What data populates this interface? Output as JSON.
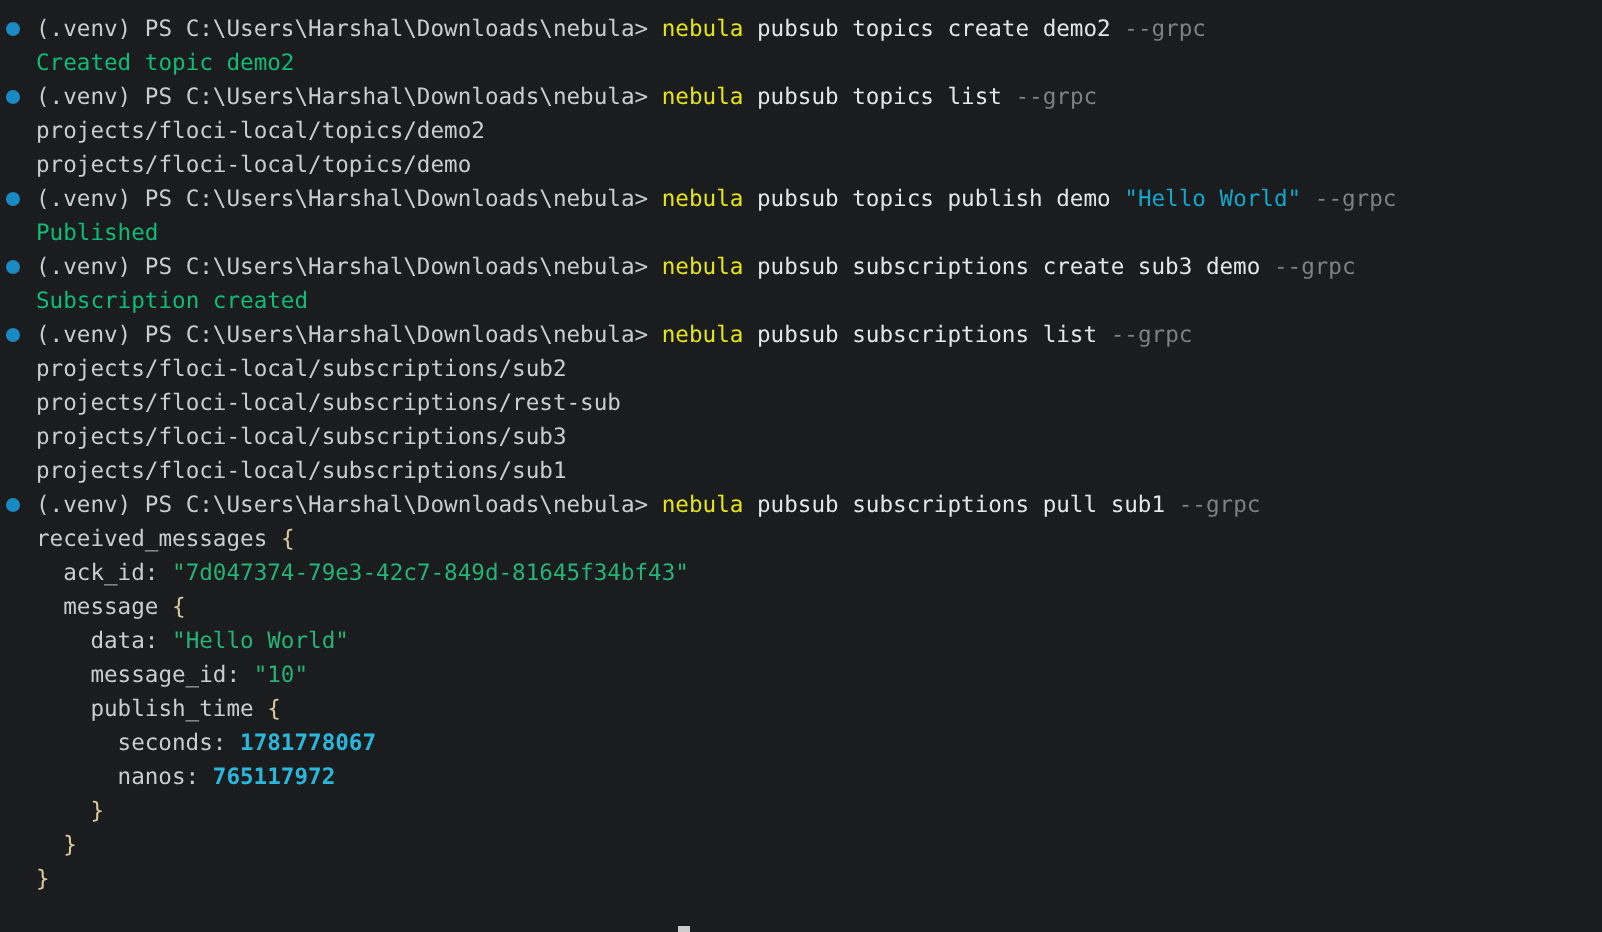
{
  "session": [
    {
      "prompt": "(.venv) PS C:\\Users\\Harshal\\Downloads\\nebula>",
      "command": [
        {
          "kind": "program",
          "text": "nebula"
        },
        {
          "kind": "args",
          "text": "pubsub topics create demo2"
        },
        {
          "kind": "flag",
          "text": "--grpc"
        }
      ],
      "output": [
        {
          "kind": "success",
          "text": "Created topic demo2"
        }
      ]
    },
    {
      "prompt": "(.venv) PS C:\\Users\\Harshal\\Downloads\\nebula>",
      "command": [
        {
          "kind": "program",
          "text": "nebula"
        },
        {
          "kind": "args",
          "text": "pubsub topics list"
        },
        {
          "kind": "flag",
          "text": "--grpc"
        }
      ],
      "output": [
        {
          "kind": "plain",
          "text": "projects/floci-local/topics/demo2"
        },
        {
          "kind": "plain",
          "text": "projects/floci-local/topics/demo"
        }
      ]
    },
    {
      "prompt": "(.venv) PS C:\\Users\\Harshal\\Downloads\\nebula>",
      "command": [
        {
          "kind": "program",
          "text": "nebula"
        },
        {
          "kind": "args",
          "text": "pubsub topics publish demo"
        },
        {
          "kind": "string",
          "text": "\"Hello World\""
        },
        {
          "kind": "flag",
          "text": "--grpc"
        }
      ],
      "output": [
        {
          "kind": "success",
          "text": "Published"
        }
      ]
    },
    {
      "prompt": "(.venv) PS C:\\Users\\Harshal\\Downloads\\nebula>",
      "command": [
        {
          "kind": "program",
          "text": "nebula"
        },
        {
          "kind": "args",
          "text": "pubsub subscriptions create sub3 demo"
        },
        {
          "kind": "flag",
          "text": "--grpc"
        }
      ],
      "output": [
        {
          "kind": "success",
          "text": "Subscription created"
        }
      ]
    },
    {
      "prompt": "(.venv) PS C:\\Users\\Harshal\\Downloads\\nebula>",
      "command": [
        {
          "kind": "program",
          "text": "nebula"
        },
        {
          "kind": "args",
          "text": "pubsub subscriptions list"
        },
        {
          "kind": "flag",
          "text": "--grpc"
        }
      ],
      "output": [
        {
          "kind": "plain",
          "text": "projects/floci-local/subscriptions/sub2"
        },
        {
          "kind": "plain",
          "text": "projects/floci-local/subscriptions/rest-sub"
        },
        {
          "kind": "plain",
          "text": "projects/floci-local/subscriptions/sub3"
        },
        {
          "kind": "plain",
          "text": "projects/floci-local/subscriptions/sub1"
        }
      ]
    },
    {
      "prompt": "(.venv) PS C:\\Users\\Harshal\\Downloads\\nebula>",
      "command": [
        {
          "kind": "program",
          "text": "nebula"
        },
        {
          "kind": "args",
          "text": "pubsub subscriptions pull sub1"
        },
        {
          "kind": "flag",
          "text": "--grpc"
        }
      ],
      "output": [
        {
          "kind": "block",
          "key": "received_messages",
          "brace": "{",
          "children": [
            {
              "kind": "field",
              "key": "ack_id:",
              "value": {
                "kind": "string",
                "text": "\"7d047374-79e3-42c7-849d-81645f34bf43\""
              }
            },
            {
              "kind": "block",
              "key": "message",
              "brace": "{",
              "children": [
                {
                  "kind": "field",
                  "key": "data:",
                  "value": {
                    "kind": "string",
                    "text": "\"Hello World\""
                  }
                },
                {
                  "kind": "field",
                  "key": "message_id:",
                  "value": {
                    "kind": "string",
                    "text": "\"10\""
                  }
                },
                {
                  "kind": "block",
                  "key": "publish_time",
                  "brace": "{",
                  "children": [
                    {
                      "kind": "field",
                      "key": "seconds:",
                      "value": {
                        "kind": "number",
                        "text": "1781778067"
                      }
                    },
                    {
                      "kind": "field",
                      "key": "nanos:",
                      "value": {
                        "kind": "number",
                        "text": "765117972"
                      }
                    }
                  ]
                },
                {
                  "kind": "close",
                  "text": "}"
                }
              ]
            },
            {
              "kind": "close",
              "text": "}"
            }
          ]
        },
        {
          "kind": "close",
          "text": "}"
        }
      ]
    }
  ]
}
